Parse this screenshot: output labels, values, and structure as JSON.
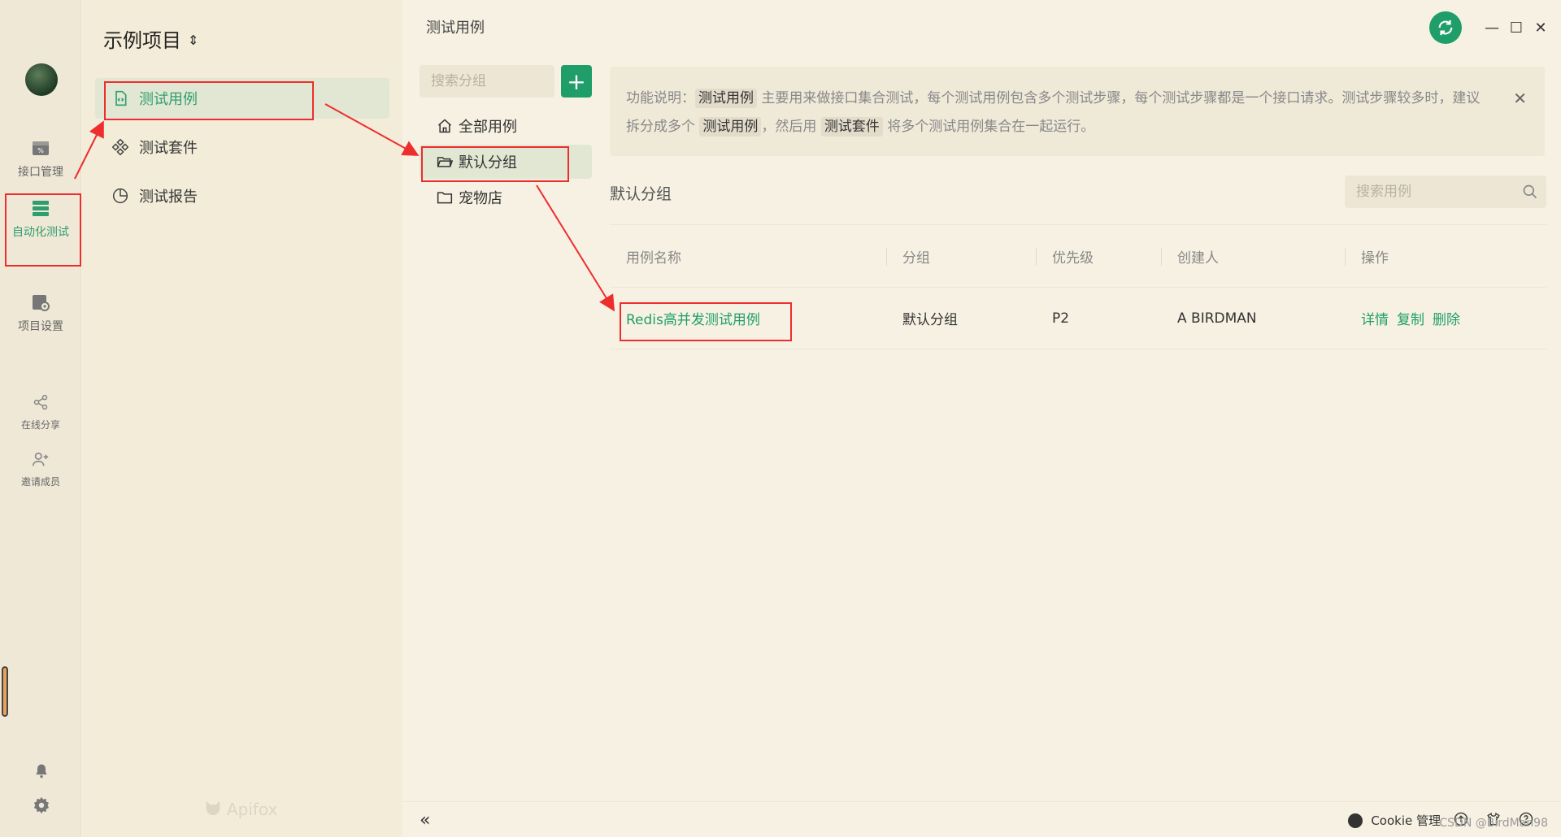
{
  "rail": {
    "items": [
      {
        "label": "接口管理",
        "icon": "api-icon"
      },
      {
        "label": "自动化测试",
        "icon": "automation-icon"
      },
      {
        "label": "项目设置",
        "icon": "project-settings-icon"
      },
      {
        "label": "在线分享",
        "icon": "share-icon"
      },
      {
        "label": "邀请成员",
        "icon": "invite-member-icon"
      }
    ]
  },
  "nav": {
    "project_title": "示例项目",
    "items": [
      {
        "label": "测试用例",
        "icon": "test-case-icon"
      },
      {
        "label": "测试套件",
        "icon": "test-suite-icon"
      },
      {
        "label": "测试报告",
        "icon": "test-report-icon"
      }
    ],
    "brand": "Apifox"
  },
  "main": {
    "breadcrumb": "测试用例",
    "group_search_placeholder": "搜索分组",
    "groups": [
      {
        "label": "全部用例",
        "icon": "home-icon"
      },
      {
        "label": "默认分组",
        "icon": "folder-open-icon"
      },
      {
        "label": "宠物店",
        "icon": "folder-icon"
      }
    ],
    "info": {
      "p1": "功能说明：",
      "code1": "测试用例",
      "p2": " 主要用来做接口集合测试，每个测试用例包含多个测试步骤，每个测试步骤都是一个接口请求。测试步骤较多时，建议拆分成多个 ",
      "code2": "测试用例",
      "p3": "，然后用 ",
      "code3": "测试套件",
      "p4": " 将多个测试用例集合在一起运行。"
    },
    "section_title": "默认分组",
    "case_search_placeholder": "搜索用例",
    "table": {
      "headers": [
        "用例名称",
        "分组",
        "优先级",
        "创建人",
        "操作"
      ],
      "rows": [
        {
          "name": "Redis高并发测试用例",
          "group": "默认分组",
          "priority": "P2",
          "creator": "A BIRDMAN",
          "actions": [
            "详情",
            "复制",
            "删除"
          ]
        }
      ]
    }
  },
  "footer": {
    "collapse": "«",
    "cookie": "Cookie 管理",
    "watermark": "CSDN @BirdMan98"
  },
  "colors": {
    "accent": "#1f9e6a",
    "annotation": "#ee2d2d",
    "background": "#f7f1e3"
  }
}
